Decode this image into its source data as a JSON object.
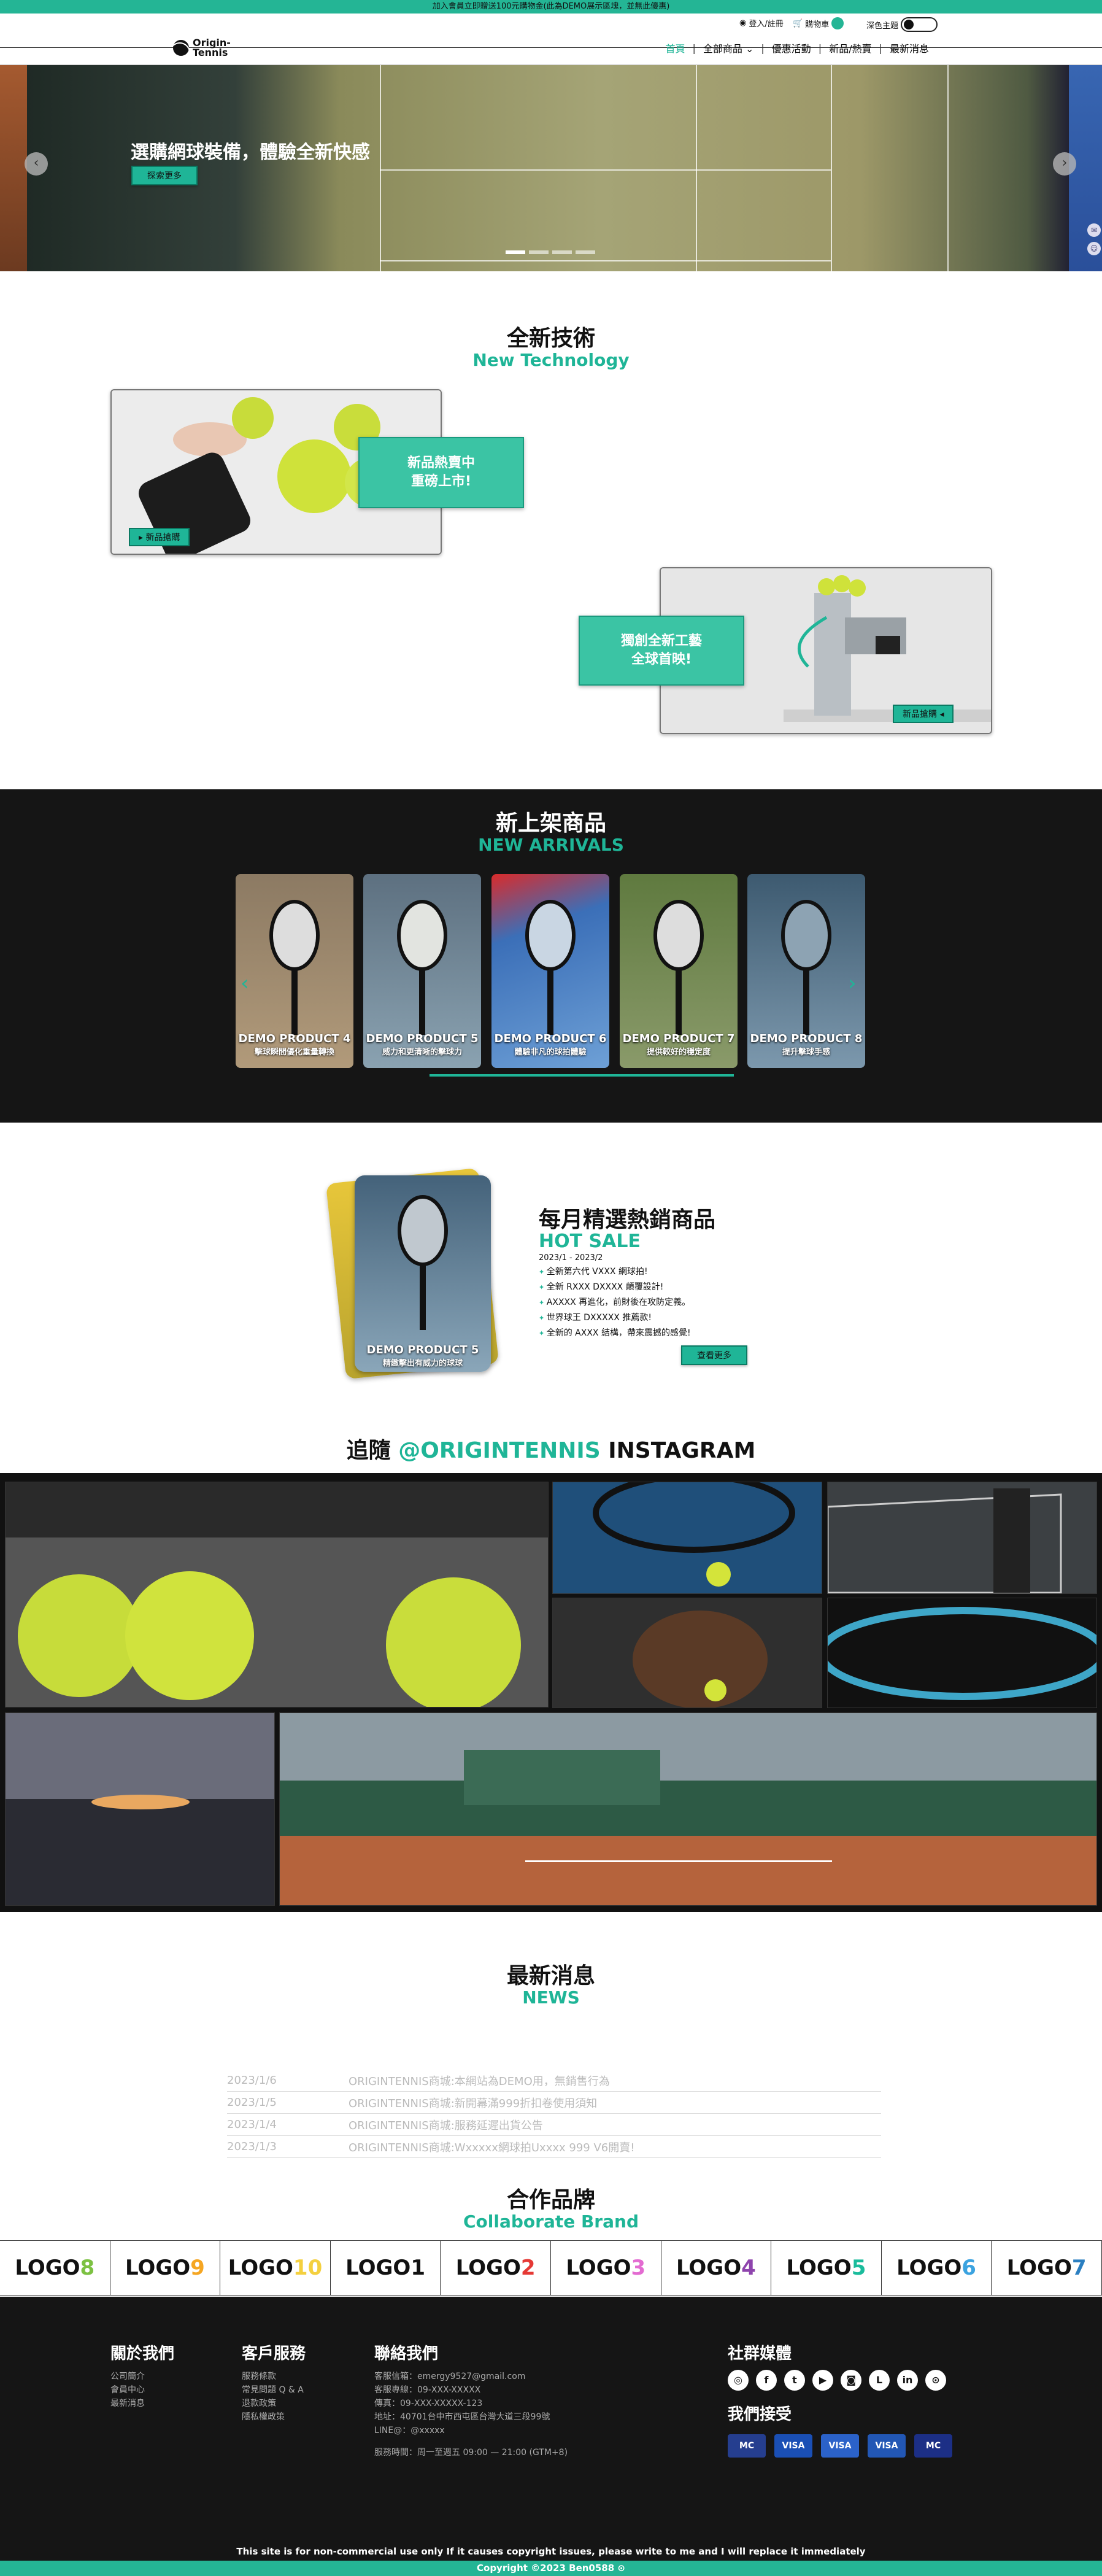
{
  "topbar": {
    "text": "加入會員立即贈送100元購物金(此為DEMO展示區塊，並無此優惠)"
  },
  "header": {
    "login": "登入/註冊",
    "cart": "購物車",
    "theme": "深色主題",
    "logo_line1": "Origin-",
    "logo_line2": "Tennis",
    "nav": [
      "首頁",
      "全部商品",
      "優惠活動",
      "新品/熱賣",
      "最新消息"
    ]
  },
  "hero": {
    "title": "選購網球裝備，體驗全新快感",
    "button": "探索更多",
    "slide_count": 4,
    "active_slide": 0
  },
  "tech": {
    "title_zh": "全新技術",
    "title_en": "New Technology",
    "card1": "新品熱賣中\n重磅上市!",
    "card1_l1": "新品熱賣中",
    "card1_l2": "重磅上市!",
    "btn1": "新品搶購",
    "card2_l1": "獨創全新工藝",
    "card2_l2": "全球首映!",
    "btn2": "新品搶購"
  },
  "arrivals": {
    "title_zh": "新上架商品",
    "title_en": "NEW ARRIVALS",
    "products": [
      {
        "name": "DEMO PRODUCT 4",
        "desc": "擊球瞬間優化重量轉換"
      },
      {
        "name": "DEMO PRODUCT 5",
        "desc": "威力和更清晰的擊球力"
      },
      {
        "name": "DEMO PRODUCT 6",
        "desc": "體驗非凡的球拍體驗"
      },
      {
        "name": "DEMO PRODUCT 7",
        "desc": "提供較好的穩定度"
      },
      {
        "name": "DEMO PRODUCT 8",
        "desc": "提升擊球手感"
      }
    ]
  },
  "hot": {
    "product_name": "DEMO PRODUCT 5",
    "product_desc": "精緻擊出有威力的球球",
    "title_zh": "每月精選熱銷商品",
    "title_en": "HOT SALE",
    "date": "2023/1 - 2023/2",
    "items": [
      "全新第六代 VXXX 網球拍!",
      "全新 RXXX DXXXX 顛覆設計!",
      "AXXXX 再進化，前財後在攻防定義。",
      "世界球王 DXXXXX 推薦款!",
      "全新的 AXXX 結構，帶來震撼的感覺!"
    ],
    "button": "查看更多"
  },
  "instagram": {
    "title_pre": "追隨 ",
    "title_handle": "@ORIGINTENNIS",
    "title_post": " INSTAGRAM"
  },
  "news": {
    "title_zh": "最新消息",
    "title_en": "NEWS",
    "rows": [
      {
        "date": "2023/1/6",
        "text": "ORIGINTENNIS商城:本網站為DEMO用，無銷售行為"
      },
      {
        "date": "2023/1/5",
        "text": "ORIGINTENNIS商城:新開幕滿999折扣卷使用須知"
      },
      {
        "date": "2023/1/4",
        "text": "ORIGINTENNIS商城:服務延遲出貨公告"
      },
      {
        "date": "2023/1/3",
        "text": "ORIGINTENNIS商城:Wxxxxx網球拍Uxxxx 999 V6開賣!"
      }
    ]
  },
  "brands": {
    "title_zh": "合作品牌",
    "title_en": "Collaborate Brand",
    "items": [
      {
        "word": "LOGO",
        "num": "8",
        "color": "#7cc142"
      },
      {
        "word": "LOGO",
        "num": "9",
        "color": "#f5a623"
      },
      {
        "word": "LOGO",
        "num": "10",
        "color": "#f4d03f"
      },
      {
        "word": "LOGO",
        "num": "1",
        "color": "#111111"
      },
      {
        "word": "LOGO",
        "num": "2",
        "color": "#e53935"
      },
      {
        "word": "LOGO",
        "num": "3",
        "color": "#e36bd1"
      },
      {
        "word": "LOGO",
        "num": "4",
        "color": "#8e44ad"
      },
      {
        "word": "LOGO",
        "num": "5",
        "color": "#1abc9c"
      },
      {
        "word": "LOGO",
        "num": "6",
        "color": "#3ba3e0"
      },
      {
        "word": "LOGO",
        "num": "7",
        "color": "#2b7fc1"
      }
    ]
  },
  "footer": {
    "about_title": "關於我們",
    "about": [
      "公司簡介",
      "會員中心",
      "最新消息"
    ],
    "service_title": "客戶服務",
    "service": [
      "服務條款",
      "常見問題 Q & A",
      "退款政策",
      "隱私權政策"
    ],
    "contact_title": "聯絡我們",
    "contact": [
      "客服信箱：emergy9527@gmail.com",
      "客服專線：09-XXX-XXXXX",
      "傳真：09-XXX-XXXXX-123",
      "地址：40701台中市西屯區台灣大道三段99號",
      "LINE@：@xxxxx"
    ],
    "hours": "服務時間：周一至週五 09:00 — 21:00 (GTM+8)",
    "social_title": "社群媒體",
    "social_icons": [
      "instagram-icon",
      "facebook-icon",
      "twitter-icon",
      "youtube-icon",
      "twitch-icon",
      "line-icon",
      "linkedin-icon",
      "github-icon"
    ],
    "pay_title": "我們接受",
    "cards": [
      "MC",
      "VISA",
      "VISA",
      "VISA",
      "MC"
    ]
  },
  "bottom": {
    "notice": "This site is for non-commercial use only If it causes copyright issues, please write to me and I will replace it immediately",
    "copyright": "Copyright ©2023 Ben0588"
  },
  "colors": {
    "accent": "#24b595",
    "dark": "#151515"
  }
}
